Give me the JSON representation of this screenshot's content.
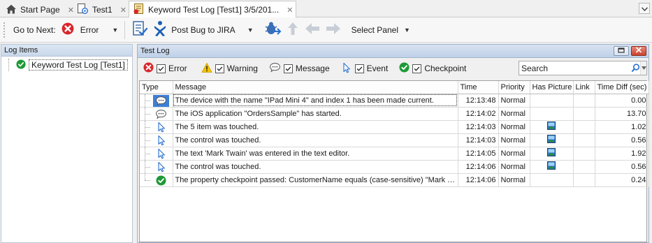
{
  "tabs": [
    {
      "label": "Start Page",
      "icon": "home-icon"
    },
    {
      "label": "Test1",
      "icon": "test-icon"
    },
    {
      "label": "Keyword Test Log [Test1] 3/5/201...",
      "icon": "log-icon"
    }
  ],
  "toolbar": {
    "goto_label": "Go to Next:",
    "error_label": "Error",
    "post_bug_label": "Post Bug to JIRA",
    "select_panel_label": "Select Panel"
  },
  "left_panel": {
    "title": "Log Items",
    "tree_item": "Keyword Test Log [Test1]"
  },
  "right_panel": {
    "title": "Test Log",
    "filters": [
      {
        "label": "Error",
        "checked": true
      },
      {
        "label": "Warning",
        "checked": true
      },
      {
        "label": "Message",
        "checked": true
      },
      {
        "label": "Event",
        "checked": true
      },
      {
        "label": "Checkpoint",
        "checked": true
      }
    ],
    "search_value": "Search"
  },
  "columns": [
    "Type",
    "Message",
    "Time",
    "Priority",
    "Has Picture",
    "Link",
    "Time Diff (sec)"
  ],
  "rows": [
    {
      "type": "message",
      "message": "The device with the name \"IPad Mini 4\" and index 1 has been made current.",
      "time": "12:13:48",
      "priority": "Normal",
      "picture": false,
      "diff": "0.00"
    },
    {
      "type": "message",
      "message": "The iOS application \"OrdersSample\" has started.",
      "time": "12:14:02",
      "priority": "Normal",
      "picture": false,
      "diff": "13.70"
    },
    {
      "type": "event",
      "message": "The 5 item was touched.",
      "time": "12:14:03",
      "priority": "Normal",
      "picture": true,
      "diff": "1.02"
    },
    {
      "type": "event",
      "message": "The control was touched.",
      "time": "12:14:03",
      "priority": "Normal",
      "picture": true,
      "diff": "0.56"
    },
    {
      "type": "event",
      "message": "The text 'Mark Twain' was entered in the text editor.",
      "time": "12:14:05",
      "priority": "Normal",
      "picture": true,
      "diff": "1.92"
    },
    {
      "type": "event",
      "message": "The control was touched.",
      "time": "12:14:06",
      "priority": "Normal",
      "picture": true,
      "diff": "0.56"
    },
    {
      "type": "checkpoint",
      "message": "The property checkpoint passed: CustomerName equals (case-sensitive) \"Mark T...",
      "time": "12:14:06",
      "priority": "Normal",
      "picture": false,
      "diff": "0.24"
    }
  ],
  "colors": {
    "error": "#d9262c",
    "accent": "#3c7fd6",
    "checkpoint": "#1d9a35",
    "warning": "#f6c500"
  }
}
